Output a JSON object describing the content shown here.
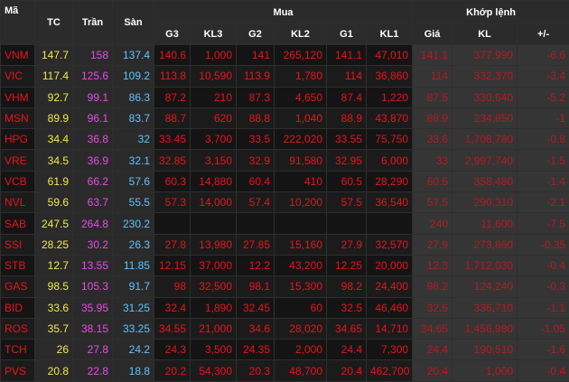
{
  "header": {
    "code": "Mã",
    "ref": "TC",
    "ceiling": "Trần",
    "floor": "Sàn",
    "buy_group": "Mua",
    "match_group": "Khớp lệnh",
    "g3": "G3",
    "kl3": "KL3",
    "g2": "G2",
    "kl2": "KL2",
    "g1": "G1",
    "kl1": "KL1",
    "price": "Giá",
    "volume": "KL",
    "change": "+/-"
  },
  "colors": {
    "ref": "#f2e94e",
    "ceiling": "#e64ce6",
    "floor": "#5cc4ff",
    "down": "#e8141c",
    "match": "#b21c22",
    "header_bg": "#2b2b2b"
  },
  "rows": [
    {
      "code": "VNM",
      "tc": "147.7",
      "tran": "158",
      "san": "137.4",
      "g3": "140.6",
      "kl3": "1,000",
      "g2": "141",
      "kl2": "265,120",
      "g1": "141.1",
      "kl1": "47,010",
      "gia": "141.1",
      "kl": "377,990",
      "chg": "-6.6"
    },
    {
      "code": "VIC",
      "tc": "117.4",
      "tran": "125.6",
      "san": "109.2",
      "g3": "113.8",
      "kl3": "10,590",
      "g2": "113.9",
      "kl2": "1,780",
      "g1": "114",
      "kl1": "36,860",
      "gia": "114",
      "kl": "332,370",
      "chg": "-3.4"
    },
    {
      "code": "VHM",
      "tc": "92.7",
      "tran": "99.1",
      "san": "86.3",
      "g3": "87.2",
      "kl3": "210",
      "g2": "87.3",
      "kl2": "4,650",
      "g1": "87.4",
      "kl1": "1,220",
      "gia": "87.5",
      "kl": "330,640",
      "chg": "-5.2"
    },
    {
      "code": "MSN",
      "tc": "89.9",
      "tran": "96.1",
      "san": "83.7",
      "g3": "88.7",
      "kl3": "620",
      "g2": "88.8",
      "kl2": "1,040",
      "g1": "88.9",
      "kl1": "43,870",
      "gia": "88.9",
      "kl": "234,850",
      "chg": "-1"
    },
    {
      "code": "HPG",
      "tc": "34.4",
      "tran": "36.8",
      "san": "32",
      "g3": "33.45",
      "kl3": "3,700",
      "g2": "33.5",
      "kl2": "222,020",
      "g1": "33.55",
      "kl1": "75,750",
      "gia": "33.6",
      "kl": "1,708,780",
      "chg": "-0.8"
    },
    {
      "code": "VRE",
      "tc": "34.5",
      "tran": "36.9",
      "san": "32.1",
      "g3": "32.85",
      "kl3": "3,150",
      "g2": "32.9",
      "kl2": "91,580",
      "g1": "32.95",
      "kl1": "6,000",
      "gia": "33",
      "kl": "2,997,740",
      "chg": "-1.5"
    },
    {
      "code": "VCB",
      "tc": "61.9",
      "tran": "66.2",
      "san": "57.6",
      "g3": "60.3",
      "kl3": "14,880",
      "g2": "60.4",
      "kl2": "410",
      "g1": "60.5",
      "kl1": "28,290",
      "gia": "60.5",
      "kl": "358,480",
      "chg": "-1.4"
    },
    {
      "code": "NVL",
      "tc": "59.6",
      "tran": "63.7",
      "san": "55.5",
      "g3": "57.3",
      "kl3": "14,000",
      "g2": "57.4",
      "kl2": "10,200",
      "g1": "57.5",
      "kl1": "36,540",
      "gia": "57.5",
      "kl": "290,310",
      "chg": "-2.1"
    },
    {
      "code": "SAB",
      "tc": "247.5",
      "tran": "264.8",
      "san": "230.2",
      "g3": "",
      "kl3": "",
      "g2": "",
      "kl2": "",
      "g1": "",
      "kl1": "",
      "gia": "240",
      "kl": "11,600",
      "chg": "-7.5"
    },
    {
      "code": "SSI",
      "tc": "28.25",
      "tran": "30.2",
      "san": "26.3",
      "g3": "27.8",
      "kl3": "13,980",
      "g2": "27.85",
      "kl2": "15,160",
      "g1": "27.9",
      "kl1": "32,570",
      "gia": "27.9",
      "kl": "273,860",
      "chg": "-0.35"
    },
    {
      "code": "STB",
      "tc": "12.7",
      "tran": "13.55",
      "san": "11.85",
      "g3": "12.15",
      "kl3": "37,000",
      "g2": "12.2",
      "kl2": "43,200",
      "g1": "12.25",
      "kl1": "20,000",
      "gia": "12.3",
      "kl": "1,712,030",
      "chg": "-0.4"
    },
    {
      "code": "GAS",
      "tc": "98.5",
      "tran": "105.3",
      "san": "91.7",
      "g3": "98",
      "kl3": "32,500",
      "g2": "98.1",
      "kl2": "15,300",
      "g1": "98.2",
      "kl1": "24,400",
      "gia": "98.2",
      "kl": "124,240",
      "chg": "-0.3"
    },
    {
      "code": "BID",
      "tc": "33.6",
      "tran": "35.95",
      "san": "31.25",
      "g3": "32.4",
      "kl3": "1,890",
      "g2": "32.45",
      "kl2": "60",
      "g1": "32.5",
      "kl1": "46,460",
      "gia": "32.5",
      "kl": "336,710",
      "chg": "-1.1"
    },
    {
      "code": "ROS",
      "tc": "35.7",
      "tran": "38.15",
      "san": "33.25",
      "g3": "34.55",
      "kl3": "21,000",
      "g2": "34.6",
      "kl2": "28,020",
      "g1": "34.65",
      "kl1": "14,710",
      "gia": "34.65",
      "kl": "1,456,980",
      "chg": "-1.05"
    },
    {
      "code": "TCH",
      "tc": "26",
      "tran": "27.8",
      "san": "24.2",
      "g3": "24.3",
      "kl3": "3,500",
      "g2": "24.35",
      "kl2": "2,000",
      "g1": "24.4",
      "kl1": "7,300",
      "gia": "24.4",
      "kl": "190,510",
      "chg": "-1.6"
    },
    {
      "code": "PVS",
      "tc": "20.8",
      "tran": "22.8",
      "san": "18.8",
      "g3": "20.2",
      "kl3": "54,300",
      "g2": "20.3",
      "kl2": "48,700",
      "g1": "20.4",
      "kl1": "462,700",
      "gia": "20.4",
      "kl": "1,000",
      "chg": "-0.4"
    }
  ]
}
